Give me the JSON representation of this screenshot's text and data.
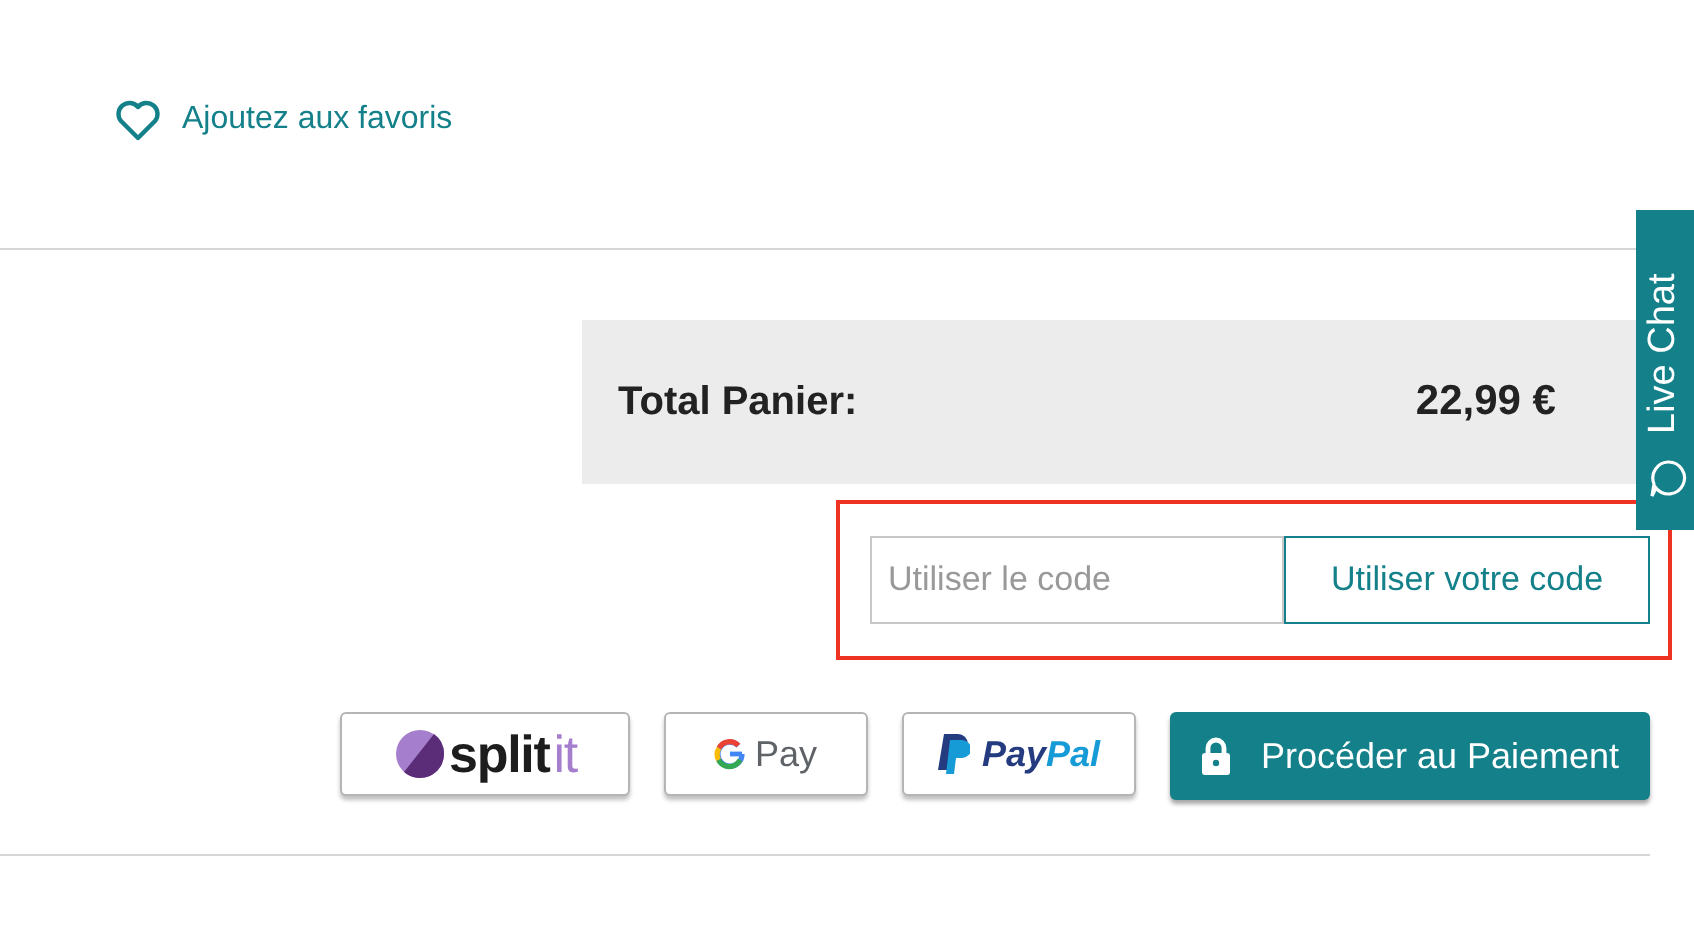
{
  "favorite_link": {
    "label": "Ajoutez aux favoris"
  },
  "cart_total": {
    "label": "Total Panier:",
    "amount": "22,99 €"
  },
  "promo_code": {
    "placeholder": "Utiliser le code",
    "button": "Utiliser votre code",
    "highlighted": true
  },
  "payment_buttons": [
    {
      "kind": "splitit",
      "parts": [
        "split",
        "it"
      ]
    },
    {
      "kind": "gpay",
      "parts": [
        "Pay"
      ]
    },
    {
      "kind": "paypal",
      "parts": [
        "Pay",
        "Pal"
      ]
    },
    {
      "kind": "checkout",
      "parts": [
        "Procéder au Paiement"
      ]
    }
  ],
  "live_chat": {
    "label": "Live Chat"
  }
}
